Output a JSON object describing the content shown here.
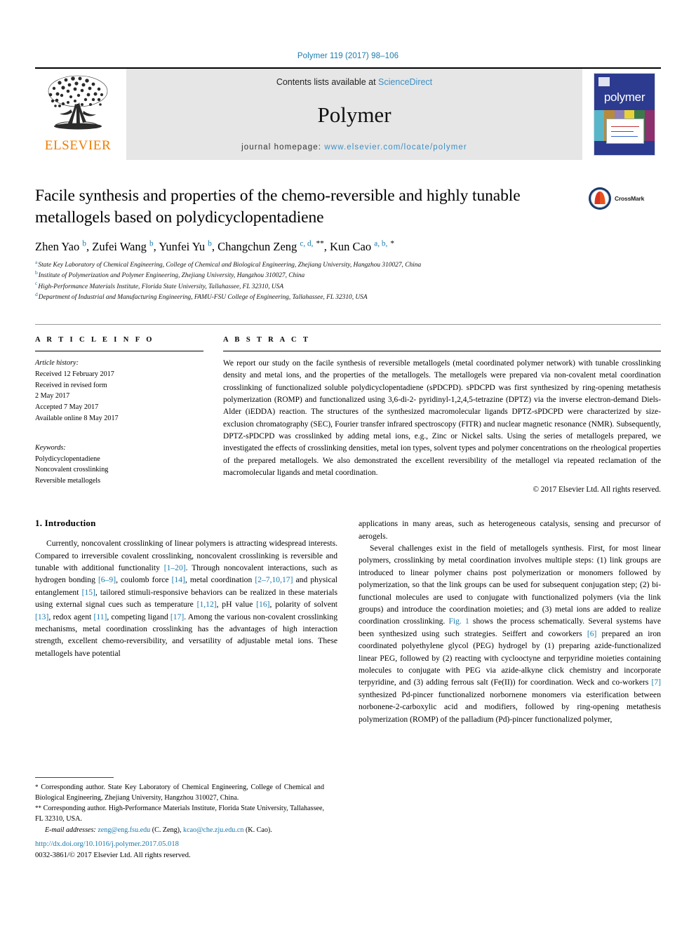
{
  "running_head": "Polymer 119 (2017) 98–106",
  "masthead": {
    "publisher_name": "ELSEVIER",
    "contents_prefix": "Contents lists available at",
    "contents_link": "ScienceDirect",
    "journal_title": "Polymer",
    "homepage_prefix": "journal homepage:",
    "homepage_url": "www.elsevier.com/locate/polymer",
    "cover_word": "polymer"
  },
  "article": {
    "title": "Facile synthesis and properties of the chemo-reversible and highly tunable metallogels based on polydicyclopentadiene",
    "crossmark_label": "CrossMark",
    "authors": [
      {
        "name": "Zhen Yao",
        "sup": "b",
        "sep": ", "
      },
      {
        "name": "Zufei Wang",
        "sup": "b",
        "sep": ", "
      },
      {
        "name": "Yunfei Yu",
        "sup": "b",
        "sep": ", "
      },
      {
        "name": "Changchun Zeng",
        "sup": "c, d,",
        "star": "**",
        "sep": ", "
      },
      {
        "name": "Kun Cao",
        "sup": "a, b,",
        "star": "*",
        "sep": ""
      }
    ],
    "affiliations": [
      {
        "label": "a",
        "text": "State Key Laboratory of Chemical Engineering, College of Chemical and Biological Engineering, Zhejiang University, Hangzhou 310027, China"
      },
      {
        "label": "b",
        "text": "Institute of Polymerization and Polymer Engineering, Zhejiang University, Hangzhou 310027, China"
      },
      {
        "label": "c",
        "text": "High-Performance Materials Institute, Florida State University, Tallahassee, FL 32310, USA"
      },
      {
        "label": "d",
        "text": "Department of Industrial and Manufacturing Engineering, FAMU-FSU College of Engineering, Tallahassee, FL 32310, USA"
      }
    ]
  },
  "article_info": {
    "heading": "A R T I C L E   I N F O",
    "history_label": "Article history:",
    "history": [
      "Received 12 February 2017",
      "Received in revised form",
      "2 May 2017",
      "Accepted 7 May 2017",
      "Available online 8 May 2017"
    ],
    "keywords_label": "Keywords:",
    "keywords": [
      "Polydicyclopentadiene",
      "Noncovalent crosslinking",
      "Reversible metallogels"
    ]
  },
  "abstract": {
    "heading": "A B S T R A C T",
    "text": "We report our study on the facile synthesis of reversible metallogels (metal coordinated polymer network) with tunable crosslinking density and metal ions, and the properties of the metallogels. The metallogels were prepared via non-covalent metal coordination crosslinking of functionalized soluble polydicyclopentadiene (sPDCPD). sPDCPD was first synthesized by ring-opening metathesis polymerization (ROMP) and functionalized using 3,6-di-2- pyridinyl-1,2,4,5-tetrazine (DPTZ) via the inverse electron-demand Diels-Alder (iEDDA) reaction. The structures of the synthesized macromolecular ligands DPTZ-sPDCPD were characterized by size-exclusion chromatography (SEC), Fourier transfer infrared spectroscopy (FITR) and nuclear magnetic resonance (NMR). Subsequently, DPTZ-sPDCPD was crosslinked by adding metal ions, e.g., Zinc or Nickel salts. Using the series of metallogels prepared, we investigated the effects of crosslinking densities, metal ion types, solvent types and polymer concentrations on the rheological properties of the prepared metallogels. We also demonstrated the excellent reversibility of the metallogel via repeated reclamation of the macromolecular ligands and metal coordination.",
    "copyright": "© 2017 Elsevier Ltd. All rights reserved."
  },
  "introduction": {
    "section_number_title": "1. Introduction",
    "left_paragraph_1_a": "Currently, noncovalent crosslinking of linear polymers is attracting widespread interests. Compared to irreversible covalent crosslinking, noncovalent crosslinking is reversible and tunable with additional functionality ",
    "ref_1_20": "[1–20]",
    "left_paragraph_1_b": ". Through noncovalent interactions, such as hydrogen bonding ",
    "ref_6_9": "[6–9]",
    "left_paragraph_1_c": ", coulomb force ",
    "ref_14": "[14]",
    "left_paragraph_1_d": ", metal coordination ",
    "ref_2_7_10_17": "[2–7,10,17]",
    "left_paragraph_1_e": " and physical entanglement ",
    "ref_15": "[15]",
    "left_paragraph_1_f": ", tailored stimuli-responsive behaviors can be realized in these materials using external signal cues such as temperature ",
    "ref_1_12": "[1,12]",
    "left_paragraph_1_g": ", pH value ",
    "ref_16": "[16]",
    "left_paragraph_1_h": ", polarity of solvent ",
    "ref_13": "[13]",
    "left_paragraph_1_i": ", redox agent ",
    "ref_11": "[11]",
    "left_paragraph_1_j": ", competing ligand ",
    "ref_17": "[17]",
    "left_paragraph_1_k": ". Among the various non-covalent crosslinking mechanisms, metal coordination crosslinking has the advantages of high interaction strength, excellent chemo-reversibility, and versatility of adjustable metal ions. These metallogels have potential",
    "right_paragraph_0": "applications in many areas, such as heterogeneous catalysis, sensing and precursor of aerogels.",
    "right_paragraph_1_a": "Several challenges exist in the field of metallogels synthesis. First, for most linear polymers, crosslinking by metal coordination involves multiple steps: (1) link groups are introduced to linear polymer chains post polymerization or monomers followed by polymerization, so that the link groups can be used for subsequent conjugation step; (2) bi-functional molecules are used to conjugate with functionalized polymers (via the link groups) and introduce the coordination moieties; and (3) metal ions are added to realize coordination crosslinking. ",
    "ref_fig1": "Fig. 1",
    "right_paragraph_1_b": " shows the process schematically. Several systems have been synthesized using such strategies. Seiffert and coworkers ",
    "ref_6": "[6]",
    "right_paragraph_1_c": " prepared an iron coordinated polyethylene glycol (PEG) hydrogel by (1) preparing azide-functionalized linear PEG, followed by (2) reacting with cyclooctyne and terpyridine moieties containing molecules to conjugate with PEG via azide-alkyne click chemistry and incorporate terpyridine, and (3) adding ferrous salt (Fe(II)) for coordination. Weck and co-workers ",
    "ref_7": "[7]",
    "right_paragraph_1_d": " synthesized Pd-pincer functionalized norbornene monomers via esterification between norbonene-2-carboxylic acid and modifiers, followed by ring-opening metathesis polymerization (ROMP) of the palladium (Pd)-pincer functionalized polymer,"
  },
  "footnotes": {
    "corresponding_1_marker": "*",
    "corresponding_1": "Corresponding author. State Key Laboratory of Chemical Engineering, College of Chemical and Biological Engineering, Zhejiang University, Hangzhou 310027, China.",
    "corresponding_2_marker": "**",
    "corresponding_2": "Corresponding author. High-Performance Materials Institute, Florida State University, Tallahassee, FL 32310, USA.",
    "email_label": "E-mail addresses:",
    "email_1": "zeng@eng.fsu.edu",
    "email_1_owner": "(C. Zeng)",
    "email_2": "kcao@che.zju.edu.cn",
    "email_2_owner": "(K. Cao)."
  },
  "footer": {
    "doi": "http://dx.doi.org/10.1016/j.polymer.2017.05.018",
    "issn_copyright": "0032-3861/© 2017 Elsevier Ltd. All rights reserved."
  },
  "colors": {
    "link_blue": "#1a7aad",
    "elsevier_orange": "#ef7d00",
    "cover_blue": "#2c3b8f",
    "masthead_grey": "#e6e6e6"
  }
}
